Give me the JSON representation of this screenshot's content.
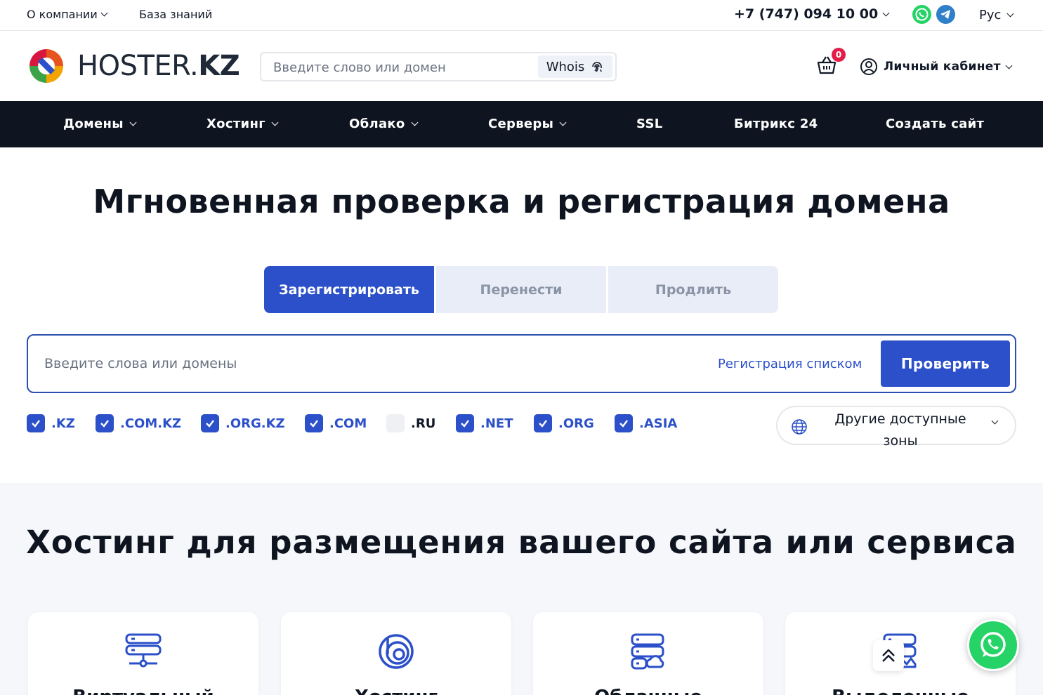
{
  "topbar": {
    "about_label": "О компании",
    "knowledge_label": "База знаний",
    "phone": "+7 (747) 094 10 00",
    "lang": "Рус"
  },
  "header": {
    "logo_text_regular": "HOSTER.",
    "logo_text_bold": "KZ",
    "search_placeholder": "Введите слово или домен",
    "whois_label": "Whois",
    "cart_count": "0",
    "cabinet_label": "Личный кабинет"
  },
  "nav": {
    "items": [
      {
        "label": "Домены"
      },
      {
        "label": "Хостинг"
      },
      {
        "label": "Облако"
      },
      {
        "label": "Серверы"
      },
      {
        "label": "SSL"
      },
      {
        "label": "Битрикс 24"
      },
      {
        "label": "Создать сайт"
      }
    ]
  },
  "domain": {
    "title": "Мгновенная проверка и регистрация домена",
    "tabs": [
      {
        "label": "Зарегистрировать",
        "active": true
      },
      {
        "label": "Перенести",
        "active": false
      },
      {
        "label": "Продлить",
        "active": false
      }
    ],
    "input_placeholder": "Введите слова или домены",
    "list_link": "Регистрация списком",
    "check_button": "Проверить",
    "zones": [
      {
        "label": ".KZ",
        "checked": true
      },
      {
        "label": ".COM.KZ",
        "checked": true
      },
      {
        "label": ".ORG.KZ",
        "checked": true
      },
      {
        "label": ".COM",
        "checked": true
      },
      {
        "label": ".RU",
        "checked": false
      },
      {
        "label": ".NET",
        "checked": true
      },
      {
        "label": ".ORG",
        "checked": true
      },
      {
        "label": ".ASIA",
        "checked": true
      }
    ],
    "other_zones_label": "Другие доступные зоны"
  },
  "hosting": {
    "title": "Хостинг для размещения вашего сайта или сервиса",
    "cards": [
      {
        "title": "Виртуальный",
        "icon": "server-stack-icon"
      },
      {
        "title": "Хостинг",
        "icon": "spiral-logo-icon"
      },
      {
        "title": "Облачные",
        "icon": "cloud-server-icon"
      },
      {
        "title": "Выделенные",
        "icon": "dedicated-server-icon"
      }
    ]
  },
  "colors": {
    "accent": "#2b50c9",
    "nav_bg": "#0f1520",
    "whatsapp": "#25d366",
    "telegram": "#2f80c9",
    "badge": "#e11d48"
  }
}
